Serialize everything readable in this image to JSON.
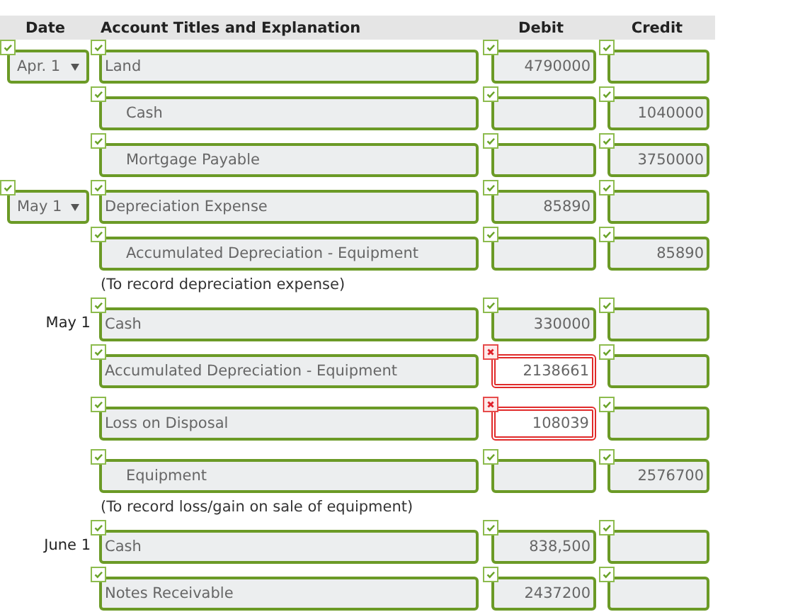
{
  "columns": [
    "Date",
    "Account Titles and Explanation",
    "Debit",
    "Credit"
  ],
  "entries": [
    {
      "kind": "line",
      "date": {
        "kind": "select",
        "value": "Apr. 1",
        "correct": true
      },
      "account": {
        "value": "Land",
        "indented": false,
        "correct": true
      },
      "debit": {
        "value": "4790000",
        "correct": true
      },
      "credit": {
        "correct": true
      }
    },
    {
      "kind": "line",
      "account": {
        "value": "Cash",
        "indented": true,
        "correct": true
      },
      "debit": {
        "correct": true
      },
      "credit": {
        "value": "1040000",
        "correct": true
      }
    },
    {
      "kind": "line",
      "account": {
        "value": "Mortgage Payable",
        "indented": true,
        "correct": true
      },
      "debit": {
        "correct": true
      },
      "credit": {
        "value": "3750000",
        "correct": true
      }
    },
    {
      "kind": "line",
      "date": {
        "kind": "select",
        "value": "May 1",
        "correct": true
      },
      "account": {
        "value": "Depreciation Expense",
        "indented": false,
        "correct": true
      },
      "debit": {
        "value": "85890",
        "correct": true
      },
      "credit": {
        "correct": true
      }
    },
    {
      "kind": "line",
      "account": {
        "value": "Accumulated Depreciation - Equipment",
        "indented": true,
        "correct": true
      },
      "debit": {
        "correct": true
      },
      "credit": {
        "value": "85890",
        "correct": true
      }
    },
    {
      "kind": "note",
      "text": "(To record depreciation expense)"
    },
    {
      "kind": "line",
      "date": {
        "kind": "label",
        "value": "May 1"
      },
      "account": {
        "value": "Cash",
        "indented": false,
        "correct": true
      },
      "debit": {
        "value": "330000",
        "correct": true
      },
      "credit": {
        "correct": true
      }
    },
    {
      "kind": "line",
      "account": {
        "value": "Accumulated Depreciation - Equipment",
        "indented": false,
        "correct": true
      },
      "debit": {
        "value": "2138661",
        "correct": false
      },
      "credit": {
        "correct": true
      }
    },
    {
      "kind": "line",
      "account": {
        "value": "Loss on Disposal",
        "indented": false,
        "correct": true
      },
      "debit": {
        "value": "108039",
        "correct": false
      },
      "credit": {
        "correct": true
      }
    },
    {
      "kind": "line",
      "account": {
        "value": "Equipment",
        "indented": true,
        "correct": true
      },
      "debit": {
        "correct": true
      },
      "credit": {
        "value": "2576700",
        "correct": true
      }
    },
    {
      "kind": "note",
      "text": "(To record loss/gain on sale of equipment)"
    },
    {
      "kind": "line",
      "date": {
        "kind": "label",
        "value": "June 1"
      },
      "account": {
        "value": "Cash",
        "indented": false,
        "correct": true
      },
      "debit": {
        "value": "838,500",
        "correct": true
      },
      "credit": {
        "correct": true
      }
    },
    {
      "kind": "line",
      "account": {
        "value": "Notes Receivable",
        "indented": false,
        "correct": true
      },
      "debit": {
        "value": "2437200",
        "correct": true
      },
      "credit": {
        "correct": true
      }
    }
  ]
}
